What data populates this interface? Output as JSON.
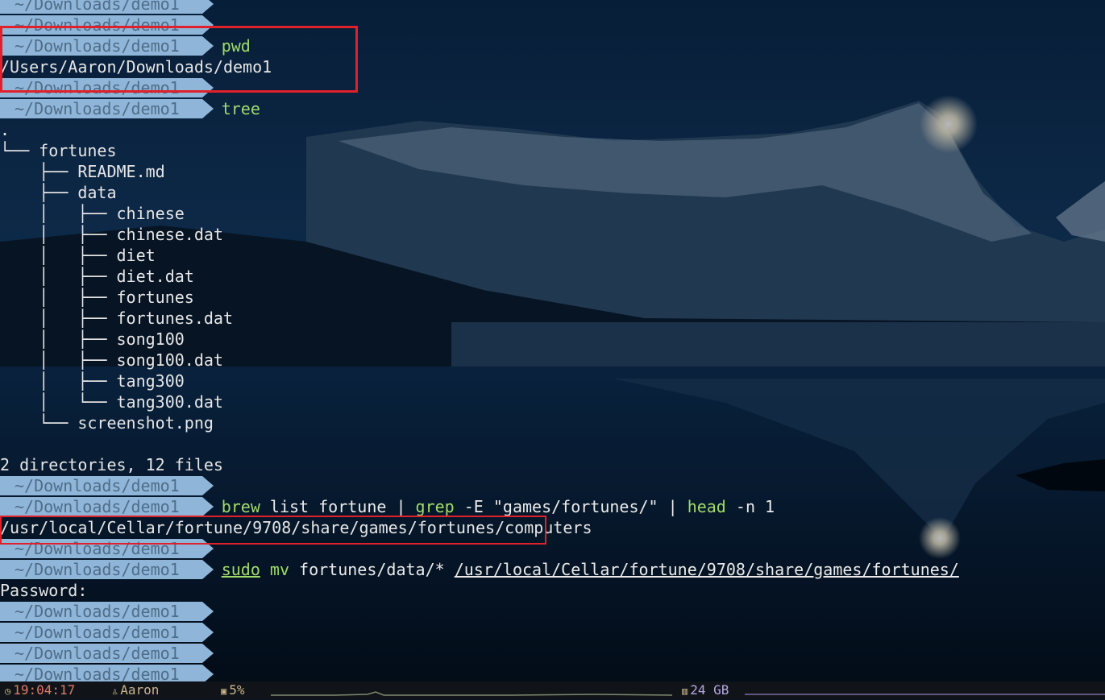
{
  "prompt_path": "~/Downloads/demo1",
  "lines": [
    {
      "type": "prompt",
      "cmd": []
    },
    {
      "type": "prompt",
      "cmd": []
    },
    {
      "type": "prompt",
      "cmd": [
        {
          "t": "pwd",
          "c": "green"
        }
      ]
    },
    {
      "type": "text",
      "text": "/Users/Aaron/Downloads/demo1"
    },
    {
      "type": "prompt",
      "cmd": []
    },
    {
      "type": "prompt",
      "cmd": [
        {
          "t": "tree",
          "c": "green"
        }
      ]
    },
    {
      "type": "text",
      "text": "."
    },
    {
      "type": "text",
      "text": "└── fortunes"
    },
    {
      "type": "text",
      "text": "    ├── README.md"
    },
    {
      "type": "text",
      "text": "    ├── data"
    },
    {
      "type": "text",
      "text": "    │   ├── chinese"
    },
    {
      "type": "text",
      "text": "    │   ├── chinese.dat"
    },
    {
      "type": "text",
      "text": "    │   ├── diet"
    },
    {
      "type": "text",
      "text": "    │   ├── diet.dat"
    },
    {
      "type": "text",
      "text": "    │   ├── fortunes"
    },
    {
      "type": "text",
      "text": "    │   ├── fortunes.dat"
    },
    {
      "type": "text",
      "text": "    │   ├── song100"
    },
    {
      "type": "text",
      "text": "    │   ├── song100.dat"
    },
    {
      "type": "text",
      "text": "    │   ├── tang300"
    },
    {
      "type": "text",
      "text": "    │   └── tang300.dat"
    },
    {
      "type": "text",
      "text": "    └── screenshot.png"
    },
    {
      "type": "text",
      "text": ""
    },
    {
      "type": "text",
      "text": "2 directories, 12 files"
    },
    {
      "type": "prompt",
      "cmd": []
    },
    {
      "type": "prompt",
      "cmd": [
        {
          "t": "brew",
          "c": "green"
        },
        {
          "t": " list fortune | ",
          "c": "white"
        },
        {
          "t": "grep",
          "c": "green"
        },
        {
          "t": " -E \"games/fortunes/\" | ",
          "c": "white"
        },
        {
          "t": "head",
          "c": "green"
        },
        {
          "t": " -n 1",
          "c": "white"
        }
      ]
    },
    {
      "type": "text",
      "text": "/usr/local/Cellar/fortune/9708/share/games/fortunes/computers"
    },
    {
      "type": "prompt",
      "cmd": []
    },
    {
      "type": "prompt",
      "cmd": [
        {
          "t": "sudo",
          "c": "green",
          "u": true
        },
        {
          "t": " ",
          "c": "white"
        },
        {
          "t": "mv",
          "c": "green"
        },
        {
          "t": " fortunes/data/* ",
          "c": "white"
        },
        {
          "t": "/usr/local/Cellar/fortune/9708/share/games/fortunes/",
          "c": "white",
          "u": true
        }
      ]
    },
    {
      "type": "text",
      "text": "Password:"
    },
    {
      "type": "prompt",
      "cmd": []
    },
    {
      "type": "prompt",
      "cmd": []
    },
    {
      "type": "prompt",
      "cmd": []
    },
    {
      "type": "prompt",
      "cmd": []
    }
  ],
  "status": {
    "time": "19:04:17",
    "user": "Aaron",
    "cpu": "5%",
    "memory": "24 GB",
    "time_icon": "clock-icon",
    "user_icon": "user-icon",
    "cpu_icon": "cpu-icon",
    "memory_icon": "memory-icon"
  },
  "colors": {
    "prompt_bg": "#8fb6d9",
    "prompt_fg": "#4f6d88",
    "command_green": "#9fdb6a",
    "highlight_red": "#e0202a",
    "status_time": "#e07a6a",
    "status_text": "#c9b48b",
    "status_memory": "#b9a6e6"
  }
}
